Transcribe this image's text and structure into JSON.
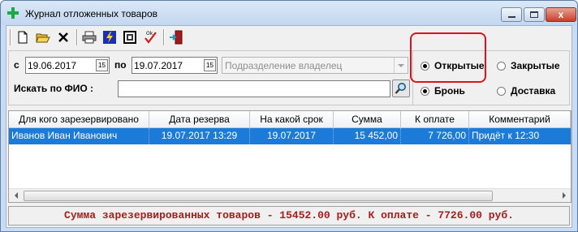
{
  "window": {
    "title": "Журнал отложенных товаров",
    "close_glyph": "x"
  },
  "toolbar": {
    "icons": [
      "new-document-icon",
      "open-folder-icon",
      "delete-icon",
      "print-icon",
      "lightning-icon",
      "image-icon",
      "check-ok-icon",
      "exit-door-icon"
    ]
  },
  "filters": {
    "from_label": "с",
    "from_date": "19.06.2017",
    "to_label": "по",
    "to_date": "19.07.2017",
    "calendar_button": "15",
    "department_placeholder": "Подразделение владелец",
    "search_label": "Искать по ФИО :",
    "search_value": ""
  },
  "status_radios": {
    "open": {
      "label": "Открытые",
      "selected": true
    },
    "closed": {
      "label": "Закрытые",
      "selected": false
    },
    "reserve": {
      "label": "Бронь",
      "selected": true
    },
    "delivery": {
      "label": "Доставка",
      "selected": false
    }
  },
  "grid": {
    "columns": [
      "Для кого зарезервировано",
      "Дата резерва",
      "На какой срок",
      "Сумма",
      "К оплате",
      "Комментарий"
    ],
    "rows": [
      {
        "client": "Иванов Иван Иванович",
        "reserve_date": "19.07.2017 13:29",
        "until": "19.07.2017",
        "sum": "15 452,00",
        "to_pay": "7 726,00",
        "comment": "Придёт к 12:30",
        "selected": true
      }
    ]
  },
  "summary": "Сумма зарезервированных товаров - 15452.00 руб. К оплате - 7726.00 руб.",
  "colors": {
    "selection": "#1c7ad9",
    "summary_text": "#a51d1d",
    "highlight_frame": "#d9141b"
  }
}
